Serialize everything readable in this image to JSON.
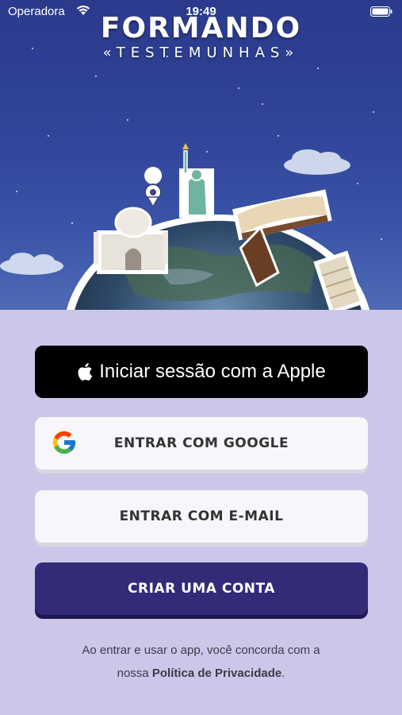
{
  "status_bar": {
    "carrier": "Operadora",
    "time": "19:49"
  },
  "brand": {
    "title": "FORMANDO",
    "subtitle": "«TESTEMUNHAS»"
  },
  "login": {
    "apple_label": "Iniciar sessão com a Apple",
    "google_label": "ENTRAR COM GOOGLE",
    "email_label": "ENTRAR COM E-MAIL",
    "create_account_label": "CRIAR UMA CONTA"
  },
  "legal": {
    "line1": "Ao entrar e usar o app, você concorda com a",
    "line2_prefix": "nossa",
    "privacy_link": "Política de Privacidade",
    "line2_suffix": "."
  },
  "colors": {
    "background": "#ccc6e9",
    "primary": "#312b78",
    "apple_button": "#000000",
    "light_button": "#f6f6fb"
  },
  "icons": [
    "wifi-icon",
    "battery-icon",
    "apple-icon",
    "google-icon"
  ]
}
